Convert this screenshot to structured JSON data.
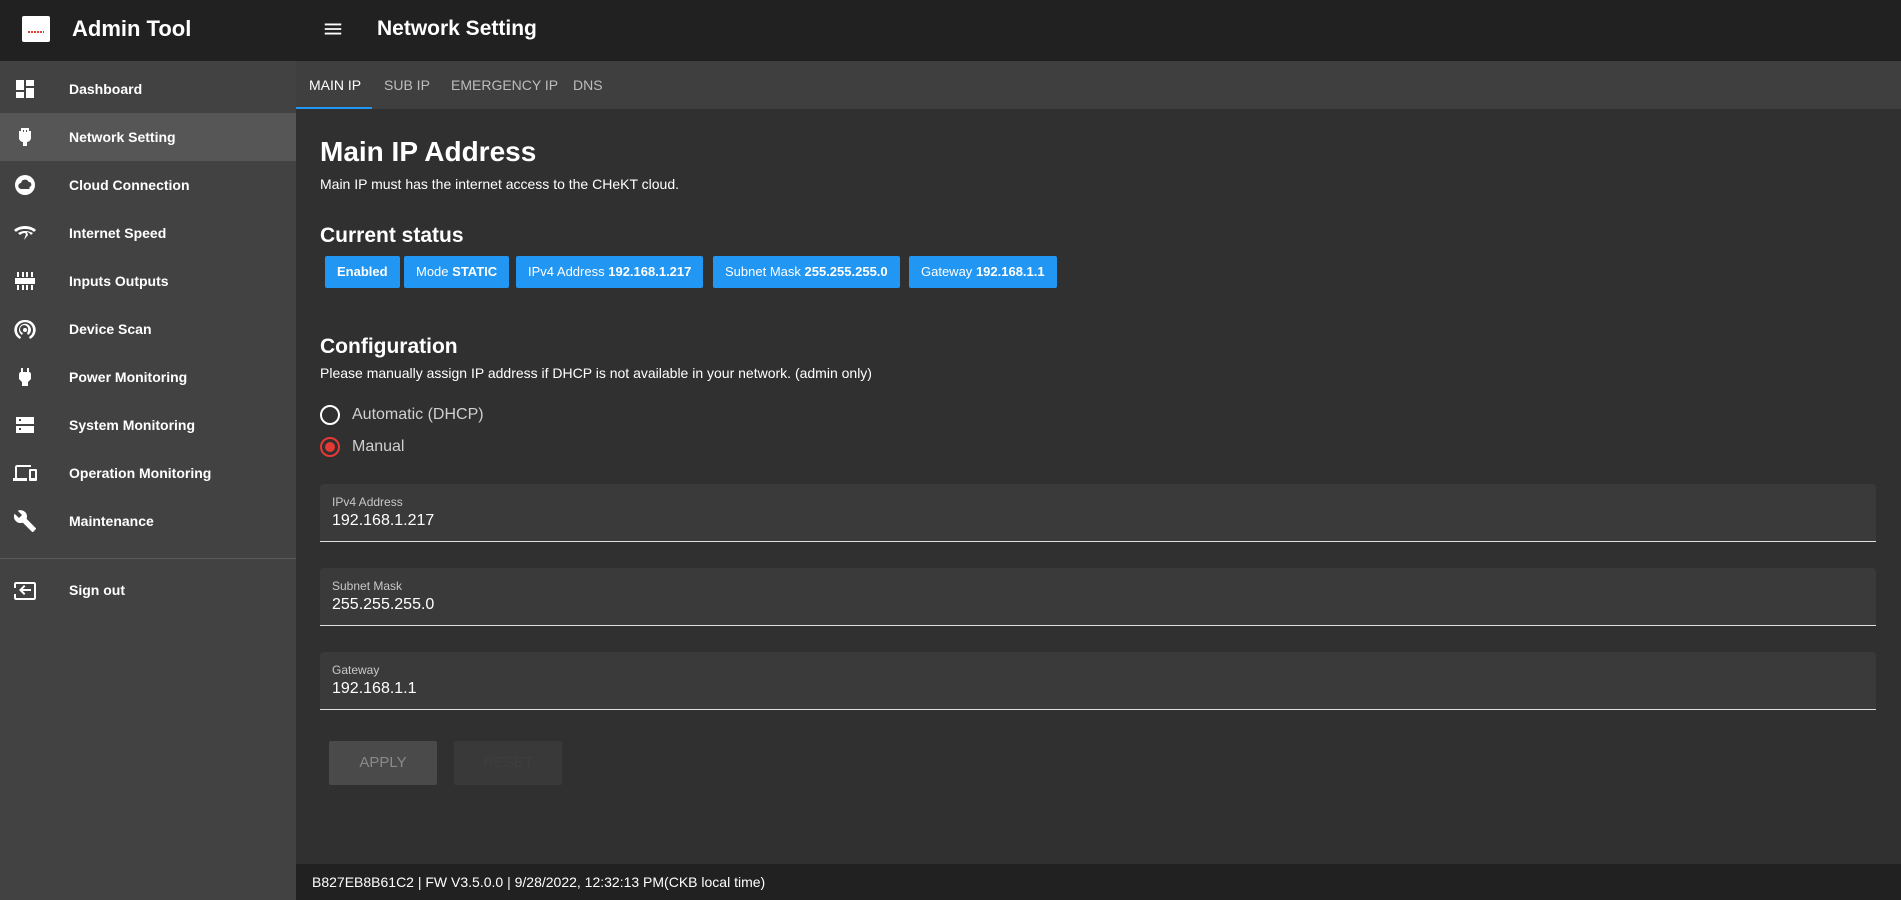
{
  "app": {
    "title": "Admin Tool",
    "page_title": "Network Setting"
  },
  "sidebar": {
    "items": [
      {
        "label": "Dashboard",
        "icon": "dashboard-icon"
      },
      {
        "label": "Network Setting",
        "icon": "ethernet-icon",
        "active": true
      },
      {
        "label": "Cloud Connection",
        "icon": "cloud-icon"
      },
      {
        "label": "Internet Speed",
        "icon": "wifi-speed-icon"
      },
      {
        "label": "Inputs Outputs",
        "icon": "io-ports-icon"
      },
      {
        "label": "Device Scan",
        "icon": "scan-icon"
      },
      {
        "label": "Power Monitoring",
        "icon": "power-plug-icon"
      },
      {
        "label": "System Monitoring",
        "icon": "server-icon"
      },
      {
        "label": "Operation Monitoring",
        "icon": "devices-icon"
      },
      {
        "label": "Maintenance",
        "icon": "wrench-icon"
      }
    ],
    "signout": {
      "label": "Sign out",
      "icon": "sign-out-icon"
    }
  },
  "tabs": [
    {
      "label": "MAIN IP",
      "active": true
    },
    {
      "label": "SUB IP"
    },
    {
      "label": "EMERGENCY IP"
    },
    {
      "label": "DNS"
    }
  ],
  "main": {
    "title": "Main IP Address",
    "subtitle": "Main IP must has the internet access to the CHeKT cloud.",
    "status_heading": "Current status",
    "chips": [
      {
        "text": "Enabled"
      },
      {
        "prefix": "Mode",
        "value": "STATIC"
      },
      {
        "prefix": "IPv4 Address",
        "value": "192.168.1.217"
      },
      {
        "prefix": "Subnet Mask",
        "value": "255.255.255.0"
      },
      {
        "prefix": "Gateway",
        "value": "192.168.1.1"
      }
    ],
    "config_heading": "Configuration",
    "config_desc": "Please manually assign IP address if DHCP is not available in your network. (admin only)",
    "radio_dhcp": "Automatic (DHCP)",
    "radio_manual": "Manual",
    "selected_mode": "Manual",
    "fields": {
      "ipv4": {
        "label": "IPv4 Address",
        "value": "192.168.1.217"
      },
      "subnet": {
        "label": "Subnet Mask",
        "value": "255.255.255.0"
      },
      "gateway": {
        "label": "Gateway",
        "value": "192.168.1.1"
      }
    },
    "apply_label": "APPLY",
    "reset_label": "RESET"
  },
  "footer": {
    "text": "B827EB8B61C2 | FW V3.5.0.0 | 9/28/2022, 12:32:13 PM(CKB local time)"
  },
  "colors": {
    "accent": "#2196f3",
    "radio_selected": "#e53935",
    "topbar": "#212121",
    "sidebar": "#424242"
  }
}
